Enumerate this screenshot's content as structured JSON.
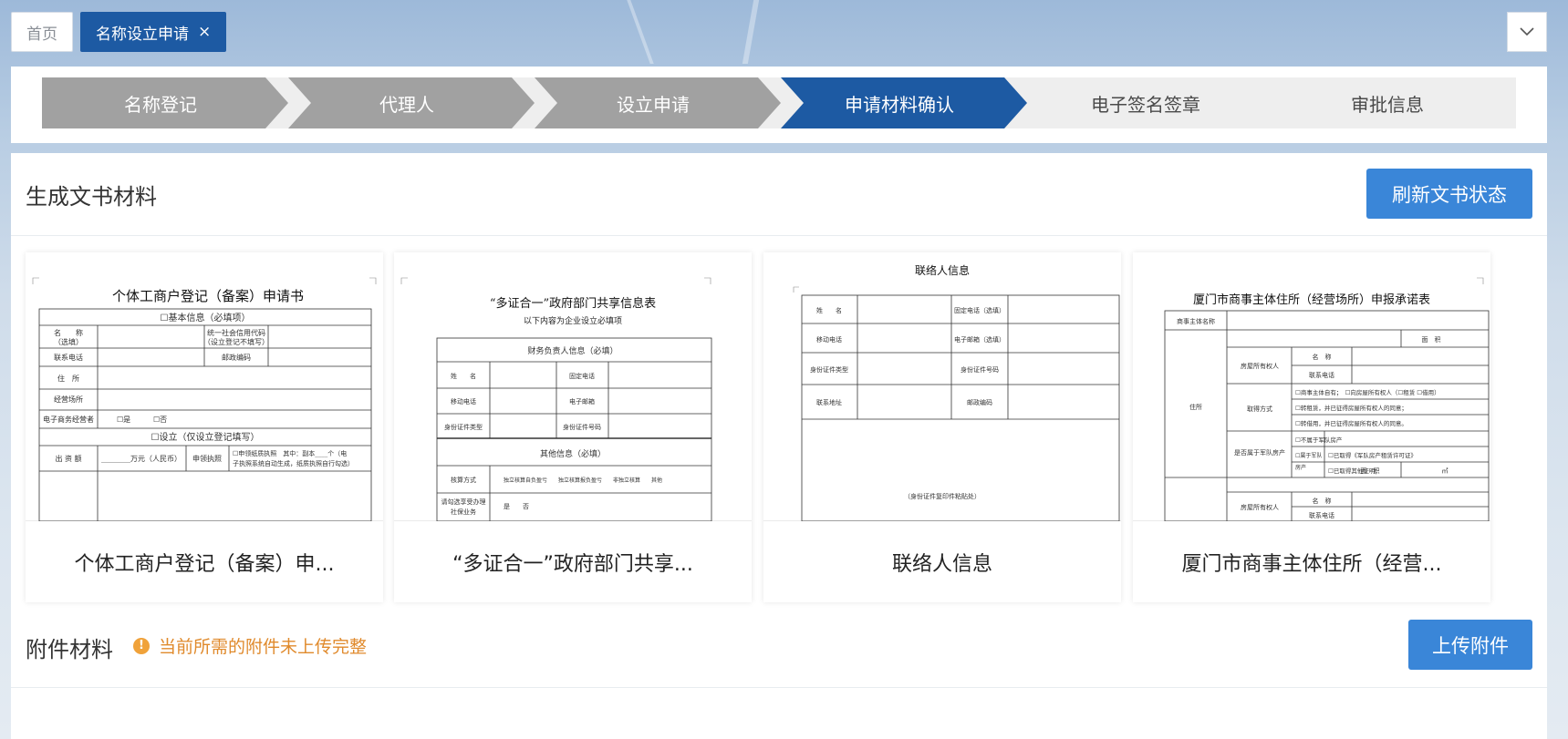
{
  "tabs": [
    {
      "label": "首页",
      "active": false
    },
    {
      "label": "名称设立申请",
      "active": true,
      "close": "×"
    }
  ],
  "steps": [
    {
      "label": "名称登记",
      "state": "done"
    },
    {
      "label": "代理人",
      "state": "done"
    },
    {
      "label": "设立申请",
      "state": "done"
    },
    {
      "label": "申请材料确认",
      "state": "current"
    },
    {
      "label": "电子签名签章",
      "state": "pending"
    },
    {
      "label": "审批信息",
      "state": "pending"
    }
  ],
  "docs_section": {
    "title": "生成文书材料",
    "refresh_label": "刷新文书状态",
    "cards": [
      {
        "name": "个体工商户登记（备案）申...",
        "preview": {
          "title": "个体工商户登记（备案）申请书",
          "h1": "☐基本信息（必填项）",
          "c1": "名　　称",
          "c2": "（选填）",
          "c3": "统一社会信用代码",
          "c4": "（设立登记不填写）",
          "c5": "联系电话",
          "c6": "邮政编码",
          "c7": "住　所",
          "c8": "经营场所",
          "c9": "电子商务经营者",
          "c10": "☐是",
          "c11": "☐否",
          "h2": "☐设立（仅设立登记填写）",
          "c12": "出 资 额",
          "c13": "________万元（人民币）",
          "c14": "申领执照",
          "c15": "☐申领纸质执照　其中：副本____个（电",
          "c16": "子执照系统自动生成，纸质执照自行勾选）"
        }
      },
      {
        "name": "“多证合一”政府部门共享...",
        "preview": {
          "title": "“多证合一”政府部门共享信息表",
          "subtitle": "以下内容为企业设立必填项",
          "h1": "财务负责人信息（必填）",
          "c1": "姓　　名",
          "c2": "固定电话",
          "c3": "移动电话",
          "c4": "电子邮箱",
          "c5": "身份证件类型",
          "c6": "身份证件号码",
          "h2": "其他信息（必填）",
          "c7": "核算方式",
          "c8": "独立核算自负盈亏　　独立核算报负盈亏　　非独立核算　　其他",
          "c9": "请勾选享受办理",
          "c10": "社保业务",
          "c11": "是　　否"
        }
      },
      {
        "name": "联络人信息",
        "preview": {
          "title": "联络人信息",
          "c1": "姓　　名",
          "c2": "固定电话（选填）",
          "c3": "移动电话",
          "c4": "电子邮箱（选填）",
          "c5": "身份证件类型",
          "c6": "身份证件号码",
          "c7": "联系地址",
          "c8": "邮政编码",
          "c9": "（身份证件复印件粘贴处）"
        }
      },
      {
        "name": "厦门市商事主体住所（经营...",
        "preview": {
          "title": "厦门市商事主体住所（经营场所）申报承诺表",
          "c1": "商事主体名称",
          "c2": "面　积",
          "c3": "房屋所有权人",
          "c4": "名　称",
          "c5": "联系电话",
          "c6": "住所",
          "c7": "取得方式",
          "c8": "☐商事主体自有；　☐向房屋所有权人（☐租赁 ☐借用）",
          "c9": "☐转租赁，并已征得房屋所有权人的同意；",
          "c10": "☐转借用，并已征得房屋所有权人的同意。",
          "c11": "是否属于军队房产",
          "c12": "☐不属于军队房产",
          "c13": "☐属于军队",
          "c14": "房产",
          "c15": "☐已取得《军队房产租赁许可证》",
          "c16": "☐已取得其他证明；",
          "c17": "面　积",
          "c18": "㎡",
          "c19": "房屋所有权人",
          "c20": "名　称",
          "c21": "联系电话"
        }
      }
    ]
  },
  "attach_section": {
    "title": "附件材料",
    "warning": "当前所需的附件未上传完整",
    "upload_label": "上传附件"
  },
  "colors": {
    "primary": "#1d5aa3",
    "button": "#3a86d8",
    "done_step": "#a1a1a1",
    "warning": "#e08a2c"
  },
  "icons": {
    "tab_close": "close-icon",
    "collapse": "chevron-down-icon",
    "warning": "warning-icon"
  }
}
